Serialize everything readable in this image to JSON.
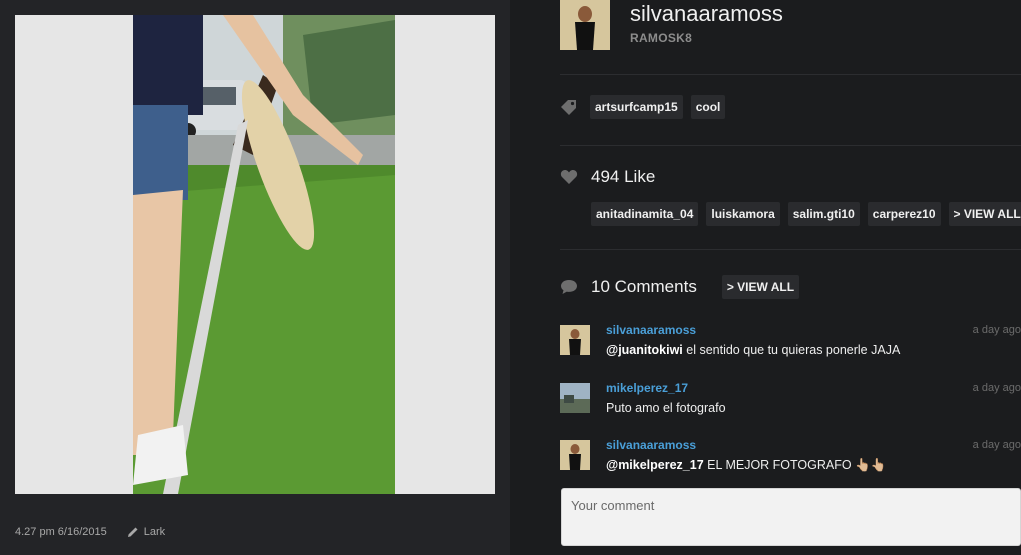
{
  "post": {
    "time": "4.27 pm 6/16/2015",
    "filter": "Lark"
  },
  "user": {
    "username": "silvanaaramoss",
    "fullname": "RAMOSK8"
  },
  "tags": [
    "artsurfcamp15",
    "cool"
  ],
  "likes": {
    "label": "494 Like",
    "users": [
      "anitadinamita_04",
      "luiskamora",
      "salim.gti10",
      "carperez10"
    ],
    "view_all": "> VIEW ALL"
  },
  "comments": {
    "label": "10 Comments",
    "view_all": "> VIEW ALL",
    "items": [
      {
        "user": "silvanaaramoss",
        "time": "a day ago",
        "mention": "@juanitokiwi",
        "text": " el sentido que tu quieras ponerle JAJA"
      },
      {
        "user": "mikelperez_17",
        "time": "a day ago",
        "mention": "",
        "text": "Puto amo el fotografo"
      },
      {
        "user": "silvanaaramoss",
        "time": "a day ago",
        "mention": "@mikelperez_17",
        "text": " EL MEJOR FOTOGRAFO 👆🏼👆🏼"
      }
    ],
    "placeholder": "Your comment"
  },
  "icons": {
    "tag": "tag-icon",
    "heart": "heart-icon",
    "comment": "speech-bubble-icon",
    "pencil": "pencil-icon"
  },
  "colors": {
    "background": "#1b1c1e",
    "left_pane": "#232427",
    "chip": "#2a2b2e",
    "link_blue": "#4a9fd8"
  }
}
